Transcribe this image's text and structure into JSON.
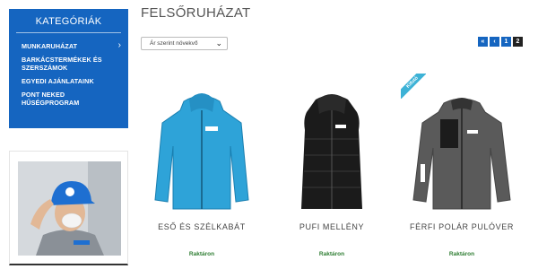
{
  "sidebar": {
    "title": "KATEGÓRIÁK",
    "items": [
      {
        "label": "MUNKARUHÁZAT",
        "has_arrow": true
      },
      {
        "label": "BARKÁCSTERMÉKEK ÉS SZERSZÁMOK"
      },
      {
        "label": "EGYEDI AJÁNLATAINK"
      },
      {
        "label": "PONT NEKED HŰSÉGPROGRAM"
      }
    ],
    "arrow": "›"
  },
  "main": {
    "title": "FELSŐRUHÁZAT",
    "sort_value": "Ár szerint növekvő",
    "pager": [
      "«",
      "‹",
      "1",
      "2"
    ],
    "active_page": "2"
  },
  "products": [
    {
      "name": "ESŐ ÉS SZÉLKABÁT",
      "stock": "Raktáron",
      "color": "#2ea3d8"
    },
    {
      "name": "PUFI MELLÉNY",
      "stock": "Raktáron",
      "color": "#1b1b1b"
    },
    {
      "name": "FÉRFI POLÁR PULÓVER",
      "stock": "Raktáron",
      "color": "#5a5a5a",
      "badge": "Kifutó"
    }
  ],
  "colors": {
    "brand": "#1565c0",
    "stock": "#2e7d32",
    "badge": "#3db2d6"
  }
}
